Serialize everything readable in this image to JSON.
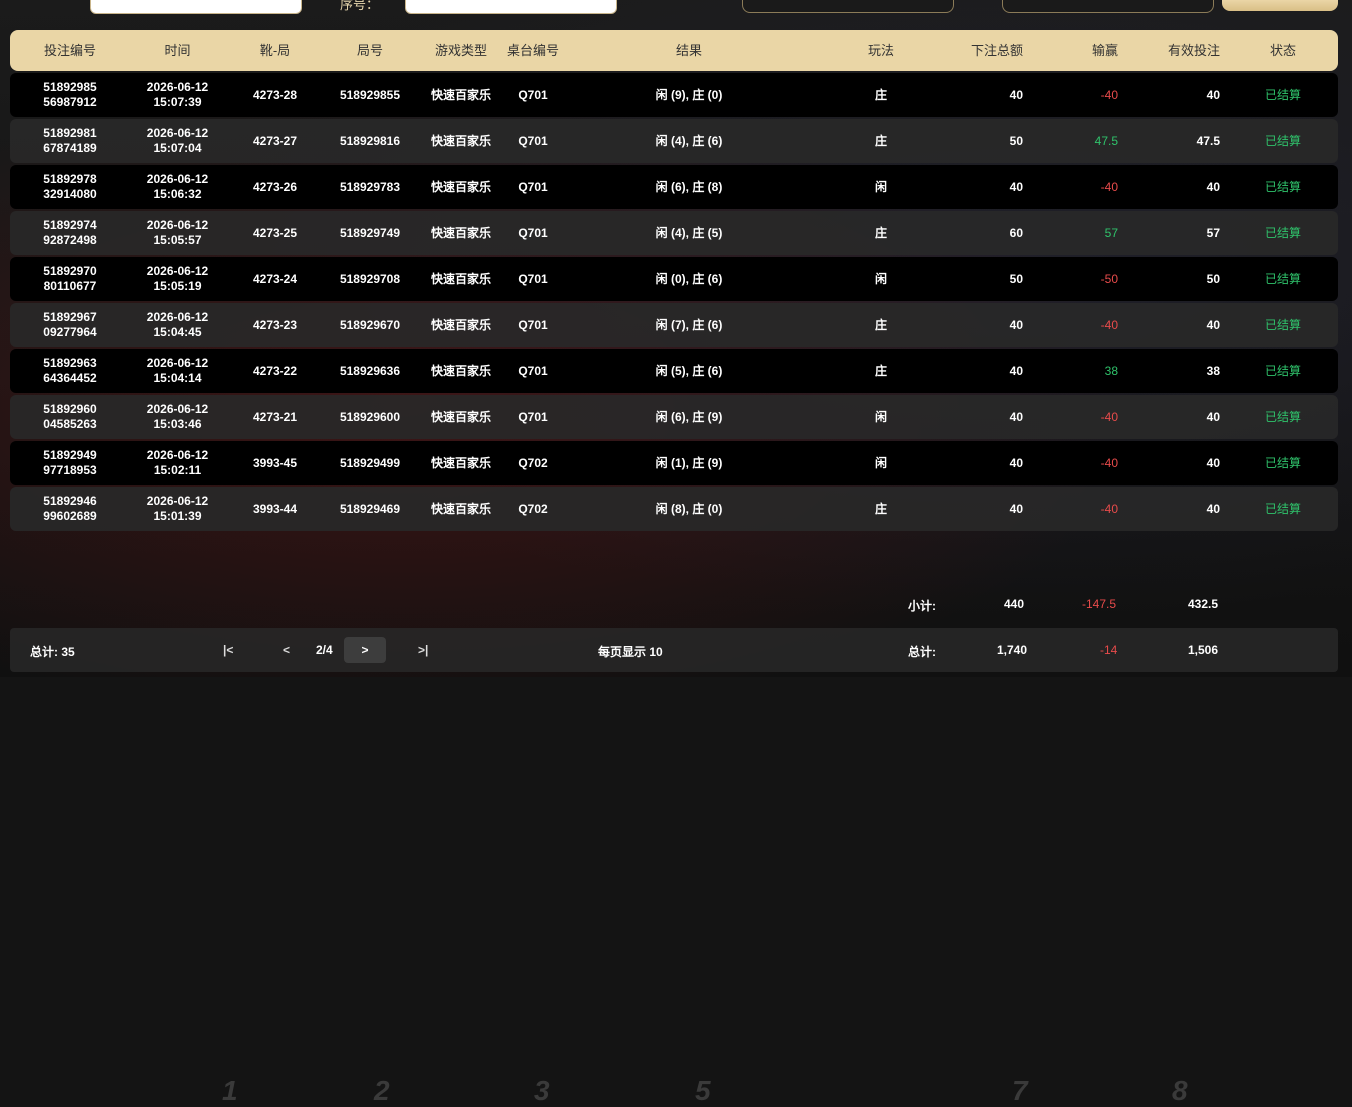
{
  "filter": {
    "label": "序号："
  },
  "table": {
    "headers": [
      "投注编号",
      "时间",
      "靴-局",
      "局号",
      "游戏类型",
      "桌台编号",
      "结果",
      "玩法",
      "下注总额",
      "输赢",
      "有效投注",
      "状态"
    ],
    "rows": [
      {
        "id1": "51892985",
        "id2": "56987912",
        "date": "2026-06-12",
        "time": "15:07:39",
        "shoe": "4273-28",
        "round": "518929855",
        "game": "快速百家乐",
        "table": "Q701",
        "result": "闲 (9), 庄 (0)",
        "play": "庄",
        "bet": "40",
        "win": "-40",
        "valid": "40",
        "status": "已结算",
        "win_sign": "neg"
      },
      {
        "id1": "51892981",
        "id2": "67874189",
        "date": "2026-06-12",
        "time": "15:07:04",
        "shoe": "4273-27",
        "round": "518929816",
        "game": "快速百家乐",
        "table": "Q701",
        "result": "闲 (4), 庄 (6)",
        "play": "庄",
        "bet": "50",
        "win": "47.5",
        "valid": "47.5",
        "status": "已结算",
        "win_sign": "pos"
      },
      {
        "id1": "51892978",
        "id2": "32914080",
        "date": "2026-06-12",
        "time": "15:06:32",
        "shoe": "4273-26",
        "round": "518929783",
        "game": "快速百家乐",
        "table": "Q701",
        "result": "闲 (6), 庄 (8)",
        "play": "闲",
        "bet": "40",
        "win": "-40",
        "valid": "40",
        "status": "已结算",
        "win_sign": "neg"
      },
      {
        "id1": "51892974",
        "id2": "92872498",
        "date": "2026-06-12",
        "time": "15:05:57",
        "shoe": "4273-25",
        "round": "518929749",
        "game": "快速百家乐",
        "table": "Q701",
        "result": "闲 (4), 庄 (5)",
        "play": "庄",
        "bet": "60",
        "win": "57",
        "valid": "57",
        "status": "已结算",
        "win_sign": "pos"
      },
      {
        "id1": "51892970",
        "id2": "80110677",
        "date": "2026-06-12",
        "time": "15:05:19",
        "shoe": "4273-24",
        "round": "518929708",
        "game": "快速百家乐",
        "table": "Q701",
        "result": "闲 (0), 庄 (6)",
        "play": "闲",
        "bet": "50",
        "win": "-50",
        "valid": "50",
        "status": "已结算",
        "win_sign": "neg"
      },
      {
        "id1": "51892967",
        "id2": "09277964",
        "date": "2026-06-12",
        "time": "15:04:45",
        "shoe": "4273-23",
        "round": "518929670",
        "game": "快速百家乐",
        "table": "Q701",
        "result": "闲 (7), 庄 (6)",
        "play": "庄",
        "bet": "40",
        "win": "-40",
        "valid": "40",
        "status": "已结算",
        "win_sign": "neg"
      },
      {
        "id1": "51892963",
        "id2": "64364452",
        "date": "2026-06-12",
        "time": "15:04:14",
        "shoe": "4273-22",
        "round": "518929636",
        "game": "快速百家乐",
        "table": "Q701",
        "result": "闲 (5), 庄 (6)",
        "play": "庄",
        "bet": "40",
        "win": "38",
        "valid": "38",
        "status": "已结算",
        "win_sign": "pos"
      },
      {
        "id1": "51892960",
        "id2": "04585263",
        "date": "2026-06-12",
        "time": "15:03:46",
        "shoe": "4273-21",
        "round": "518929600",
        "game": "快速百家乐",
        "table": "Q701",
        "result": "闲 (6), 庄 (9)",
        "play": "闲",
        "bet": "40",
        "win": "-40",
        "valid": "40",
        "status": "已结算",
        "win_sign": "neg"
      },
      {
        "id1": "51892949",
        "id2": "97718953",
        "date": "2026-06-12",
        "time": "15:02:11",
        "shoe": "3993-45",
        "round": "518929499",
        "game": "快速百家乐",
        "table": "Q702",
        "result": "闲 (1), 庄 (9)",
        "play": "闲",
        "bet": "40",
        "win": "-40",
        "valid": "40",
        "status": "已结算",
        "win_sign": "neg"
      },
      {
        "id1": "51892946",
        "id2": "99602689",
        "date": "2026-06-12",
        "time": "15:01:39",
        "shoe": "3993-44",
        "round": "518929469",
        "game": "快速百家乐",
        "table": "Q702",
        "result": "闲 (8), 庄 (0)",
        "play": "庄",
        "bet": "40",
        "win": "-40",
        "valid": "40",
        "status": "已结算",
        "win_sign": "neg"
      }
    ]
  },
  "subtotal": {
    "label": "小计:",
    "bet": "440",
    "win": "-147.5",
    "valid": "432.5"
  },
  "footer": {
    "total_count": "总计: 35",
    "first": "|<",
    "prev": "<",
    "page": "2/4",
    "next": ">",
    "last": ">|",
    "per_page": "每页显示 10",
    "total_label": "总计:",
    "total_bet": "1,740",
    "total_win": "-14",
    "total_valid": "1,506"
  },
  "background_numbers": [
    "1",
    "2",
    "3",
    "5",
    "7",
    "8"
  ]
}
